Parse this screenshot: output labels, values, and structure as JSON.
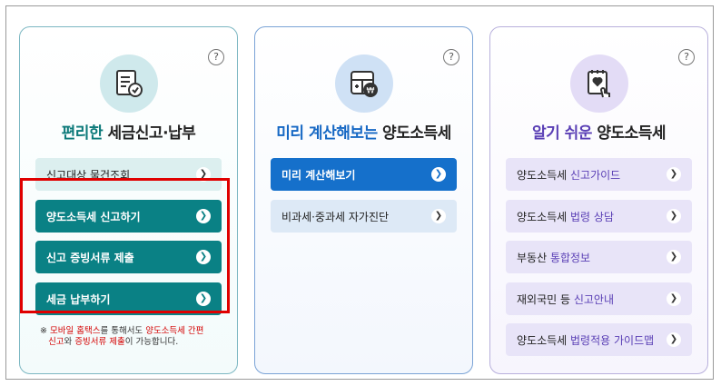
{
  "help_label": "?",
  "arrow": "❯",
  "card1": {
    "title_highlight": "편리한",
    "title_rest": " 세금신고·납부",
    "buttons": [
      {
        "label": "신고대상 물건조회",
        "style": "light"
      },
      {
        "label": "양도소득세 신고하기",
        "style": "dark"
      },
      {
        "label": "신고 증빙서류 제출",
        "style": "dark"
      },
      {
        "label": "세금 납부하기",
        "style": "dark"
      }
    ],
    "note": {
      "prefix": "※ ",
      "p1": "모바일 홈택스",
      "p2": "를 통해서도 ",
      "p3": "양도소득세 간편",
      "p4": "신고",
      "p5": "와 ",
      "p6": "증빙서류 제출",
      "p7": "이 가능합니다."
    }
  },
  "card2": {
    "title_highlight": "미리 계산해보는",
    "title_rest": " 양도소득세",
    "buttons": [
      {
        "label": "미리 계산해보기",
        "style": "dark"
      },
      {
        "label": "비과세·중과세 자가진단",
        "style": "light"
      }
    ]
  },
  "card3": {
    "title_highlight": "알기 쉬운",
    "title_rest": " 양도소득세",
    "buttons": [
      {
        "pre": "양도소득세 ",
        "hl": "신고가이드"
      },
      {
        "pre": "양도소득세 ",
        "hl": "법령 상담"
      },
      {
        "pre": "부동산 ",
        "hl": "통합정보"
      },
      {
        "pre": "재외국민 등 ",
        "hl": "신고안내"
      },
      {
        "pre": "양도소득세 ",
        "hl": "법령적용 가이드맵"
      }
    ]
  }
}
